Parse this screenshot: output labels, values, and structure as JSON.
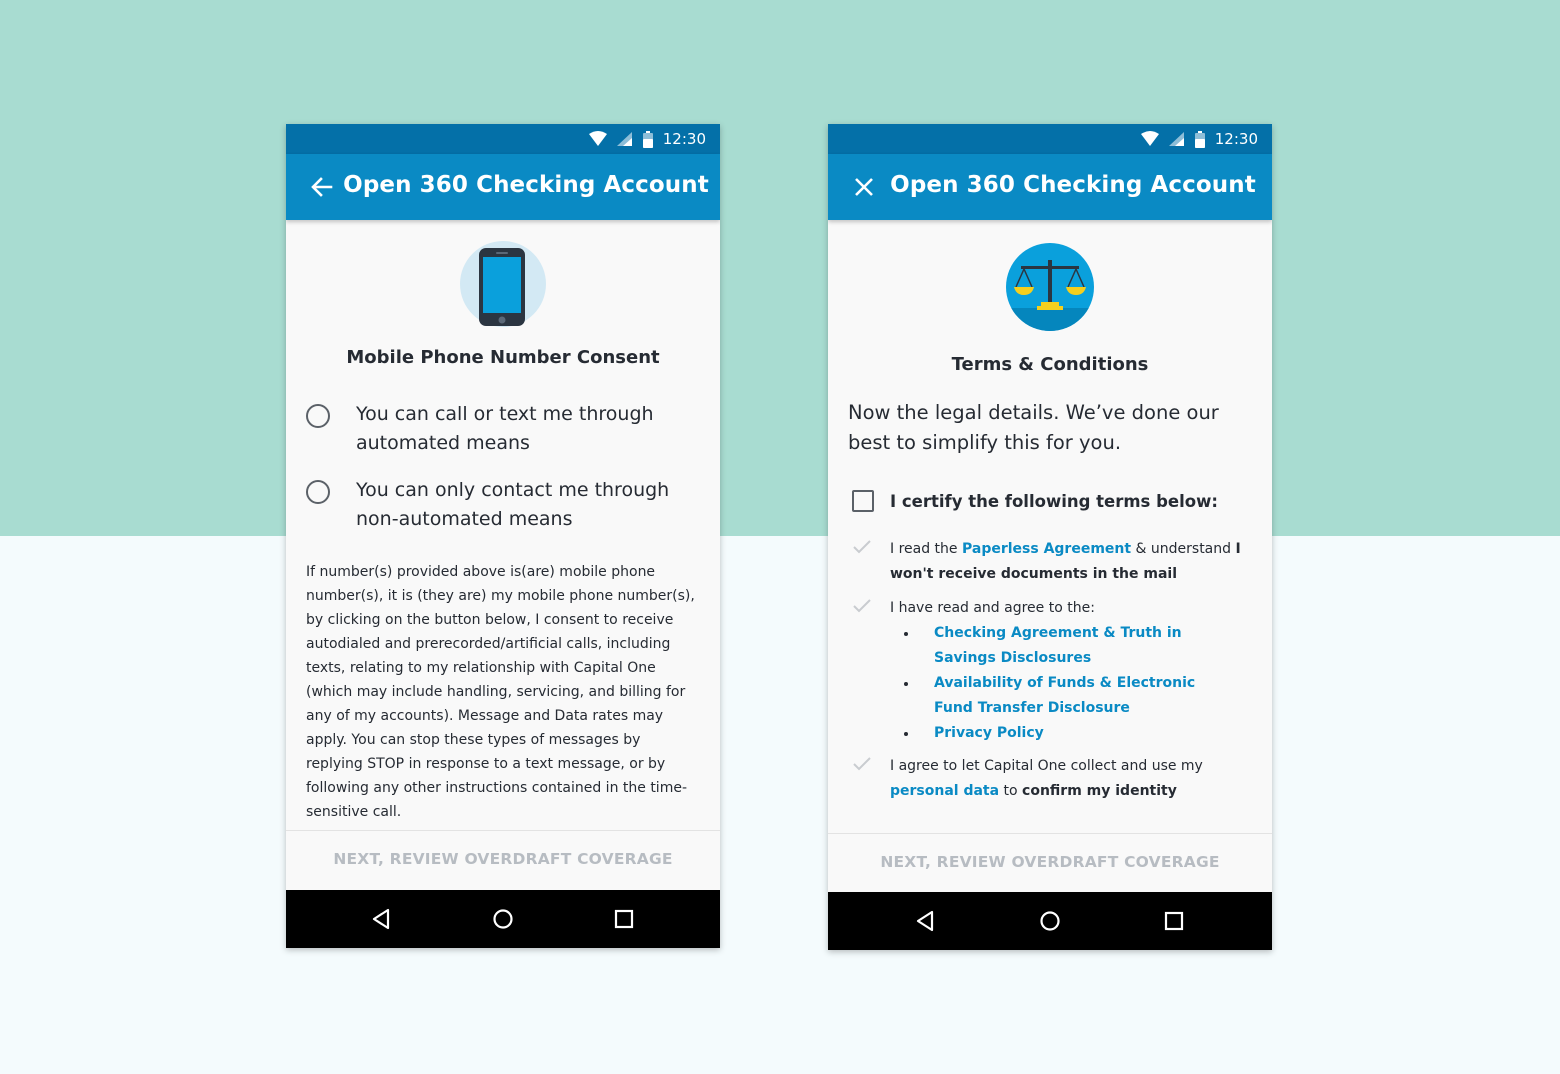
{
  "status_bar": {
    "time": "12:30"
  },
  "screens": {
    "consent": {
      "app_title": "Open 360 Checking Account",
      "section_title": "Mobile Phone Number Consent",
      "options": [
        {
          "label": "You can call or text me through automated means"
        },
        {
          "label": "You can only contact me through non-automated means"
        }
      ],
      "legal_text": "If number(s) provided above is(are) mobile phone number(s), it is (they are) my mobile phone number(s), by clicking on the button below, I consent to receive autodialed and prerecorded/artificial calls, including texts, relating to my relationship with Capital One (which may include handling, servicing, and billing for any of my accounts). Message and Data rates may apply. You can stop these types of messages by replying STOP in response to a text message, or by following any other instructions contained in the time-sensitive call.",
      "cta": "NEXT, REVIEW OVERDRAFT COVERAGE"
    },
    "terms": {
      "app_title": "Open 360 Checking Account",
      "section_title": "Terms & Conditions",
      "intro": "Now the legal details. We’ve done our best to simplify this for you.",
      "certify_label": "I certify the following terms below:",
      "term1": {
        "prefix": "I read the ",
        "link": "Paperless Agreement",
        "middle": " & understand ",
        "strong": "I won't receive documents in the mail"
      },
      "term2": {
        "text": "I have read and agree to the:",
        "links": [
          "Checking Agreement & Truth in Savings Disclosures",
          "Availability of Funds & Electronic Fund Transfer Disclosure",
          "Privacy Policy"
        ]
      },
      "term3": {
        "prefix": "I agree to let Capital One collect and use my ",
        "link": "personal data",
        "middle": " to ",
        "strong": "confirm my identity"
      },
      "cta": "NEXT, REVIEW OVERDRAFT COVERAGE"
    }
  },
  "colors": {
    "status_bar": "#0470a8",
    "app_bar": "#0a8ac4",
    "link": "#0a8ac4",
    "background_top": "#a8dcd1",
    "background_bottom": "#f4fbfd"
  },
  "icons": [
    "wifi-icon",
    "signal-icon",
    "battery-icon",
    "back-arrow-icon",
    "close-icon",
    "mobile-phone-icon",
    "scales-of-justice-icon",
    "nav-back-icon",
    "nav-home-icon",
    "nav-recents-icon",
    "check-icon"
  ]
}
